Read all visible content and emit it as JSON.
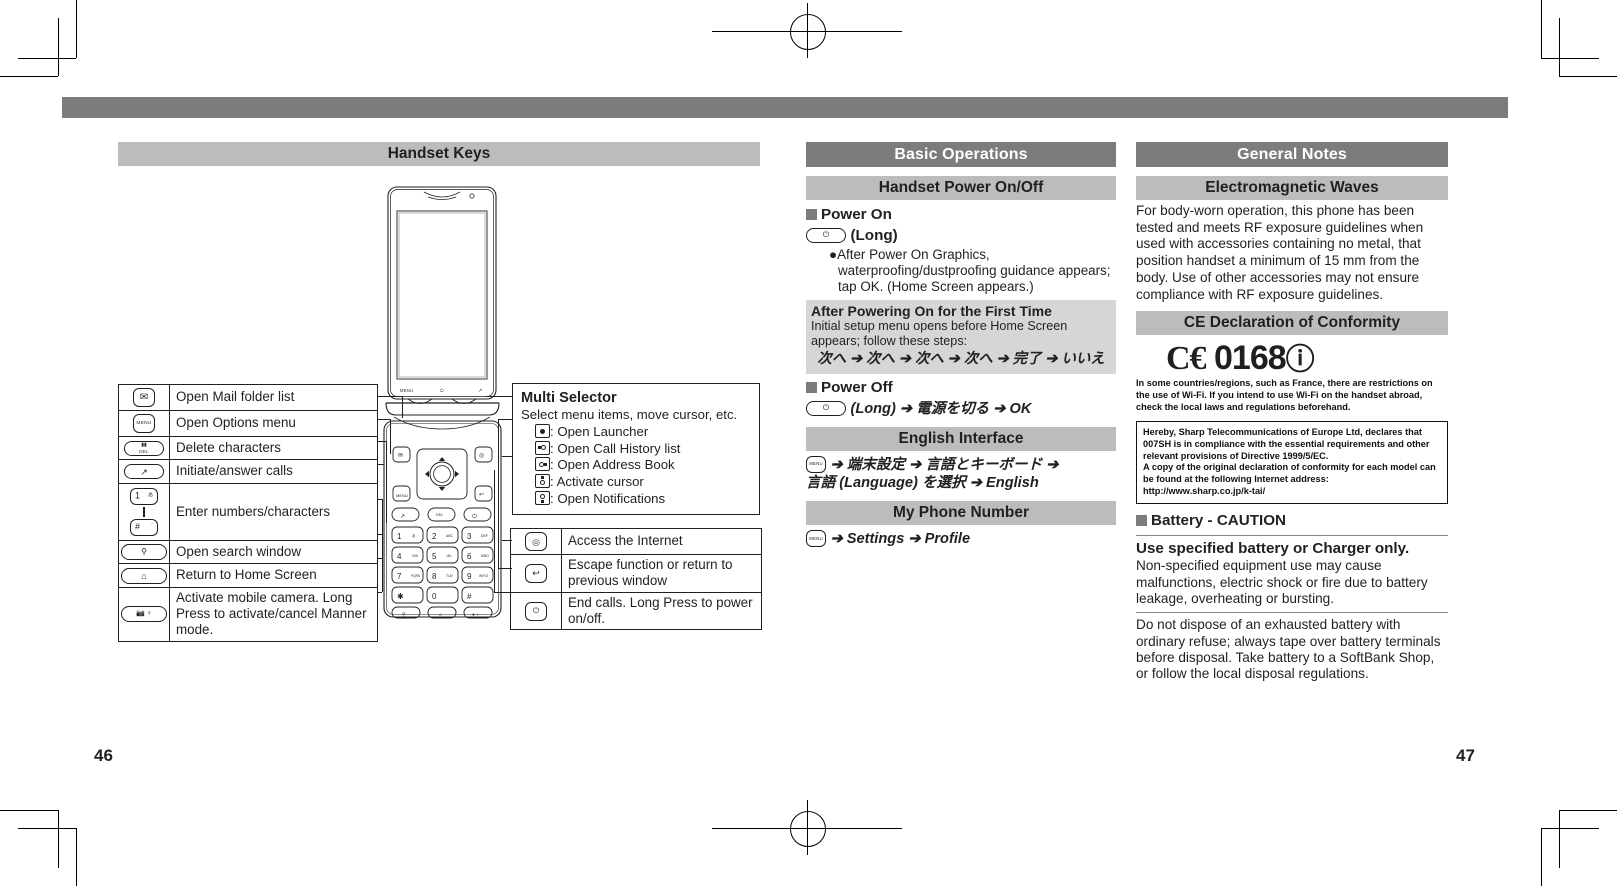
{
  "page": {
    "left_number": "46",
    "right_number": "47"
  },
  "left": {
    "title": "Handset Keys",
    "key_rows": [
      {
        "icon": "mail-key-icon",
        "glyph": "✉",
        "sub": "",
        "text": "Open Mail folder list"
      },
      {
        "icon": "menu-key-icon",
        "glyph": "",
        "sub": "MENU",
        "text": "Open Options menu"
      },
      {
        "icon": "delete-key-icon",
        "glyph": "",
        "sub": "DEL",
        "text": "Delete characters"
      },
      {
        "icon": "call-key-icon",
        "glyph": "⤴",
        "sub": "",
        "text": "Initiate/answer calls"
      },
      {
        "icon": "number-keys-icon",
        "glyph": "1 – #",
        "sub": "",
        "text": "Enter numbers/characters"
      },
      {
        "icon": "search-key-icon",
        "glyph": "⚲",
        "sub": "",
        "text": "Open search window"
      },
      {
        "icon": "home-key-icon",
        "glyph": "⌂",
        "sub": "",
        "text": "Return to Home Screen"
      },
      {
        "icon": "camera-key-icon",
        "glyph": "■ ♀",
        "sub": "",
        "text": "Activate mobile camera. Long Press to activate/cancel Manner mode."
      }
    ],
    "multi_selector": {
      "title": "Multi Selector",
      "desc": "Select menu items, move cursor, etc.",
      "items": [
        {
          "icon": "center-key-icon",
          "text": ": Open Launcher"
        },
        {
          "icon": "left-key-icon",
          "text": ": Open Call History list"
        },
        {
          "icon": "right-key-icon",
          "text": ": Open Address Book"
        },
        {
          "icon": "up-key-icon",
          "text": ": Activate cursor"
        },
        {
          "icon": "down-key-icon",
          "text": ": Open Notifications"
        }
      ]
    },
    "right_key_rows": [
      {
        "icon": "internet-key-icon",
        "glyph": "◎",
        "text": "Access the Internet"
      },
      {
        "icon": "back-key-icon",
        "glyph": "↩",
        "text": "Escape function or return to previous window"
      },
      {
        "icon": "power-key-icon",
        "glyph": "⏻",
        "text": "End calls. Long Press to power on/off."
      }
    ],
    "phone": {
      "soft_keys": [
        "MENU",
        "⏻",
        "⤴"
      ],
      "keypad": [
        {
          "num": "1",
          "sub": "あ"
        },
        {
          "num": "2",
          "sub": "ABC"
        },
        {
          "num": "3",
          "sub": "DEF"
        },
        {
          "num": "4",
          "sub": "GHI"
        },
        {
          "num": "5",
          "sub": "JKL"
        },
        {
          "num": "6",
          "sub": "MNO"
        },
        {
          "num": "7",
          "sub": "PQRS"
        },
        {
          "num": "8",
          "sub": "TUV"
        },
        {
          "num": "9",
          "sub": "WXYZ"
        },
        {
          "num": "✳",
          "sub": ""
        },
        {
          "num": "0",
          "sub": ""
        },
        {
          "num": "#",
          "sub": ""
        }
      ]
    }
  },
  "middle": {
    "section_title": "Basic Operations",
    "power": {
      "title": "Handset Power On/Off",
      "power_on_label": "Power On",
      "power_on_step": "(Long)",
      "power_on_note": "After Power On Graphics, waterproofing/dustproofing guidance appears; tap OK. (Home Screen appears.)",
      "first_time": {
        "title": "After Powering On for the First Time",
        "body": "Initial setup menu opens before Home Screen appears; follow these steps:",
        "steps": "次へ ➔ 次へ ➔ 次へ ➔ 次へ ➔ 完了 ➔ いいえ"
      },
      "power_off_label": "Power Off",
      "power_off_step": "(Long) ➔ 電源を切る ➔ OK"
    },
    "english": {
      "title": "English Interface",
      "line1": "➔ 端末設定 ➔ 言語とキーボード ➔",
      "line2": "言語 (Language) を選択 ➔ English"
    },
    "phone_number": {
      "title": "My Phone Number",
      "line": "➔ Settings ➔ Profile"
    }
  },
  "right": {
    "section_title": "General Notes",
    "emw": {
      "title": "Electromagnetic Waves",
      "body": "For body-worn operation, this phone has been tested and meets RF exposure guidelines when used with accessories containing no metal, that position handset a minimum of 15 mm from the body. Use of other accessories may not ensure compliance with RF exposure guidelines."
    },
    "ce": {
      "title": "CE Declaration of Conformity",
      "mark": "ℂ€ 0168ⓘ",
      "mark_text": "0168",
      "notice": "In some countries/regions, such as France, there are restrictions on the use of Wi-Fi. If you intend to use Wi-Fi on the handset abroad, check the local laws and regulations beforehand.",
      "box": "Hereby, Sharp Telecommunications of Europe Ltd, declares that 007SH is in compliance with the essential requirements and other relevant provisions of Directive 1999/5/EC.\nA copy of the original declaration of conformity for each model can be found at the following Internet address:\nhttp://www.sharp.co.jp/k-tai/"
    },
    "battery": {
      "title": "Battery - CAUTION",
      "head1": "Use specified battery or Charger only.",
      "body1": "Non-specified equipment use may cause malfunctions, electric shock or fire due to battery leakage, overheating or bursting.",
      "body2": "Do not dispose of an exhausted battery with ordinary refuse; always tape over battery terminals before disposal. Take battery to a SoftBank Shop, or follow the local disposal regulations."
    }
  }
}
